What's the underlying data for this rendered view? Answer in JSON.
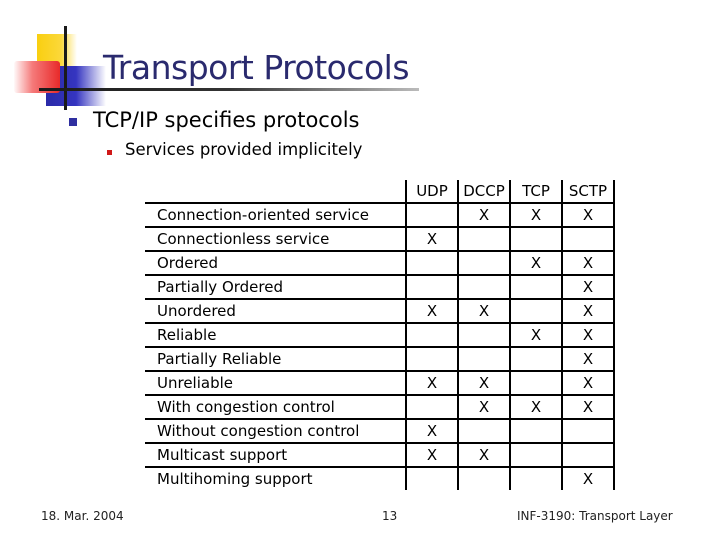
{
  "slide": {
    "title": "Transport Protocols",
    "bullet_level1": "TCP/IP specifies protocols",
    "bullet_level2": "Services provided implicitely"
  },
  "table": {
    "columns": [
      "UDP",
      "DCCP",
      "TCP",
      "SCTP"
    ],
    "rows": [
      {
        "label": "Connection-oriented service",
        "cells": [
          "",
          "X",
          "X",
          "X"
        ]
      },
      {
        "label": "Connectionless service",
        "cells": [
          "X",
          "",
          "",
          ""
        ]
      },
      {
        "label": "Ordered",
        "cells": [
          "",
          "",
          "X",
          "X"
        ]
      },
      {
        "label": "Partially Ordered",
        "cells": [
          "",
          "",
          "",
          "X"
        ]
      },
      {
        "label": "Unordered",
        "cells": [
          "X",
          "X",
          "",
          "X"
        ]
      },
      {
        "label": "Reliable",
        "cells": [
          "",
          "",
          "X",
          "X"
        ]
      },
      {
        "label": "Partially Reliable",
        "cells": [
          "",
          "",
          "",
          "X"
        ]
      },
      {
        "label": "Unreliable",
        "cells": [
          "X",
          "X",
          "",
          "X"
        ]
      },
      {
        "label": "With congestion control",
        "cells": [
          "",
          "X",
          "X",
          "X"
        ]
      },
      {
        "label": "Without congestion control",
        "cells": [
          "X",
          "",
          "",
          ""
        ]
      },
      {
        "label": "Multicast support",
        "cells": [
          "X",
          "X",
          "",
          ""
        ]
      },
      {
        "label": "Multihoming support",
        "cells": [
          "",
          "",
          "",
          "X"
        ]
      }
    ]
  },
  "footer": {
    "date": "18. Mar. 2004",
    "page_number": "13",
    "course": "INF-3190: Transport Layer"
  },
  "colors": {
    "title": "#2a2a6e",
    "bullet_level1": "#2f2fa0",
    "bullet_level2": "#d01818"
  }
}
